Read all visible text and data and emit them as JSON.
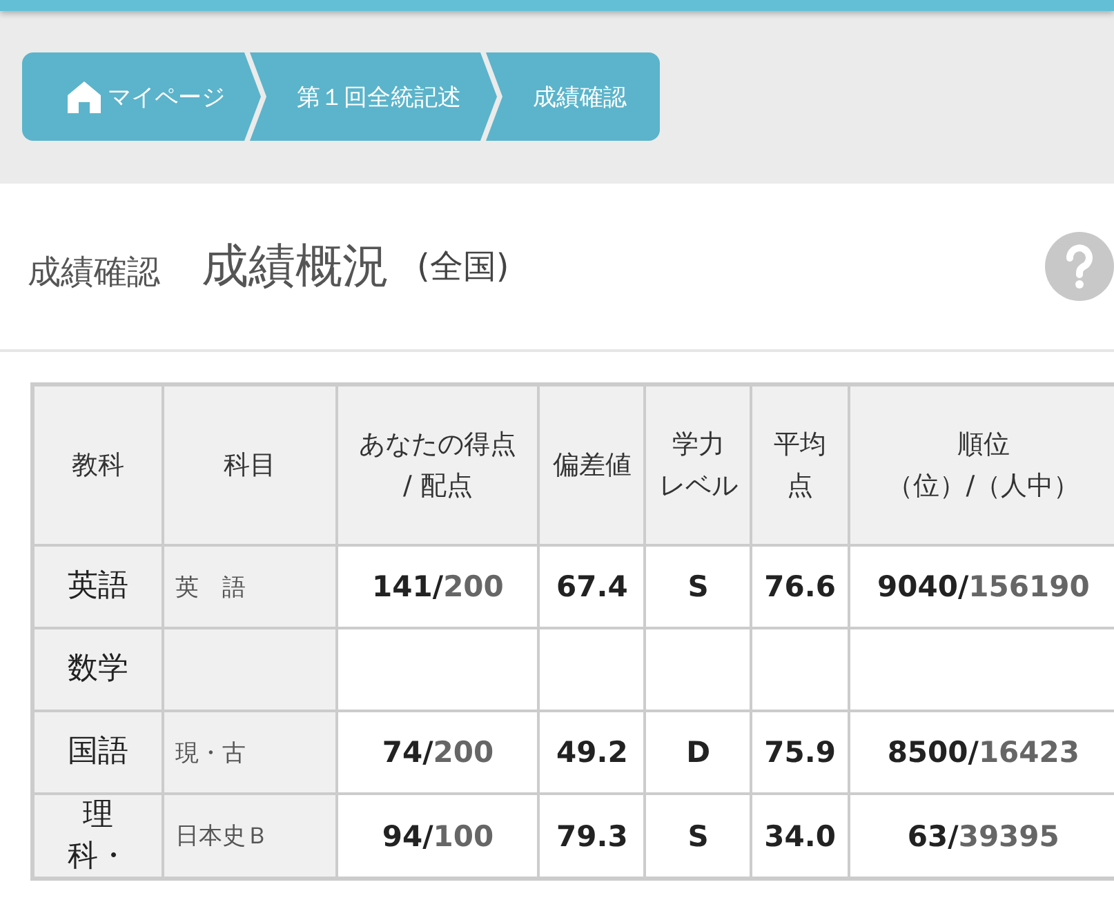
{
  "breadcrumb": [
    {
      "label": "マイページ",
      "kind": "home"
    },
    {
      "label": "第１回全統記述",
      "kind": "link"
    },
    {
      "label": "成績確認",
      "kind": "link"
    }
  ],
  "header": {
    "section": "成績確認",
    "title": "成績概況",
    "scope": "(全国)"
  },
  "table": {
    "columns": [
      {
        "lines": [
          "教科"
        ]
      },
      {
        "lines": [
          "科目"
        ]
      },
      {
        "lines": [
          "あなたの得点",
          "/ 配点"
        ]
      },
      {
        "lines": [
          "偏差値"
        ]
      },
      {
        "lines": [
          "学力",
          "レベル"
        ]
      },
      {
        "lines": [
          "平均",
          "点"
        ]
      },
      {
        "lines": [
          "順位",
          "（位）/（人中）"
        ]
      }
    ],
    "rows": [
      {
        "subject": "英語",
        "course": "英　語",
        "score": "141/",
        "max": "200",
        "deviation": "67.4",
        "level_grade": "S",
        "average": "76.6",
        "rank": "9040/",
        "total": "156190"
      },
      {
        "subject": "数学"
      },
      {
        "subject": "国語",
        "course": "現・古",
        "score": "74/",
        "max": "200",
        "deviation": "49.2",
        "level_grade": "D",
        "average": "75.9",
        "rank": "8500/",
        "total": "16423"
      },
      {
        "subject": "理科・",
        "course": "日本史Ｂ",
        "score": "94/",
        "max": "100",
        "deviation": "79.3",
        "level_grade": "S",
        "average": "34.0",
        "rank": "63/",
        "total": "39395"
      }
    ]
  }
}
